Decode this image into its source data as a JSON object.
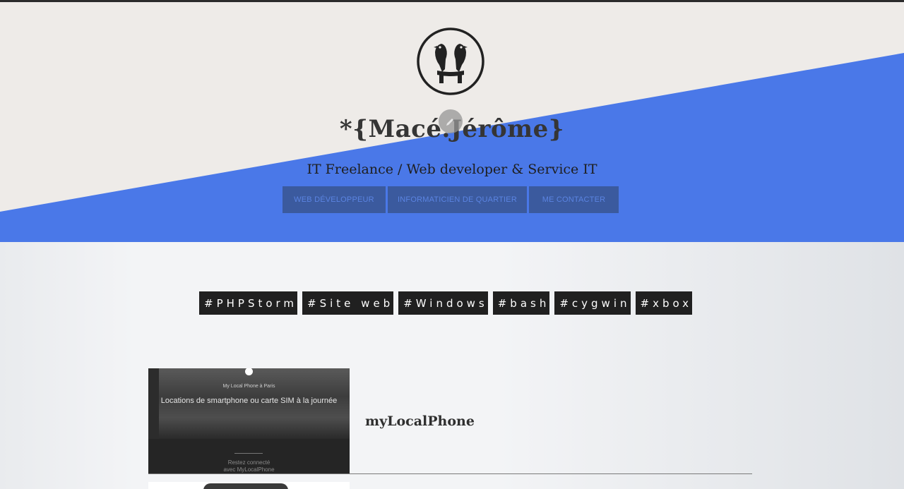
{
  "site": {
    "title": "*{Macé.Jérôme}",
    "tagline": "IT Freelance / Web developer & Service IT"
  },
  "nav": {
    "items": [
      {
        "label": "Web Développeur"
      },
      {
        "label": "Informaticien de quartier"
      },
      {
        "label": "Me contacter"
      }
    ]
  },
  "tags": [
    "#PHPStorm",
    "#Site web",
    "#Windows",
    "#bash",
    "#cygwin",
    "#xbox"
  ],
  "projects": [
    {
      "title": "myLocalPhone",
      "thumb": {
        "brand": "My Local Phone à Paris",
        "headline": "Locations de smartphone ou carte SIM à la journée",
        "footer_line1": "Restez connecté",
        "footer_line2": "avec MyLocalPhone"
      }
    }
  ],
  "colors": {
    "hero_bg": "#eeebe8",
    "accent_blue": "#4a78e8",
    "nav_bg": "#3b5a9e",
    "tag_bg": "#202020"
  },
  "icons": {
    "logo": "two-birds-logo",
    "edit": "pencil-icon"
  }
}
